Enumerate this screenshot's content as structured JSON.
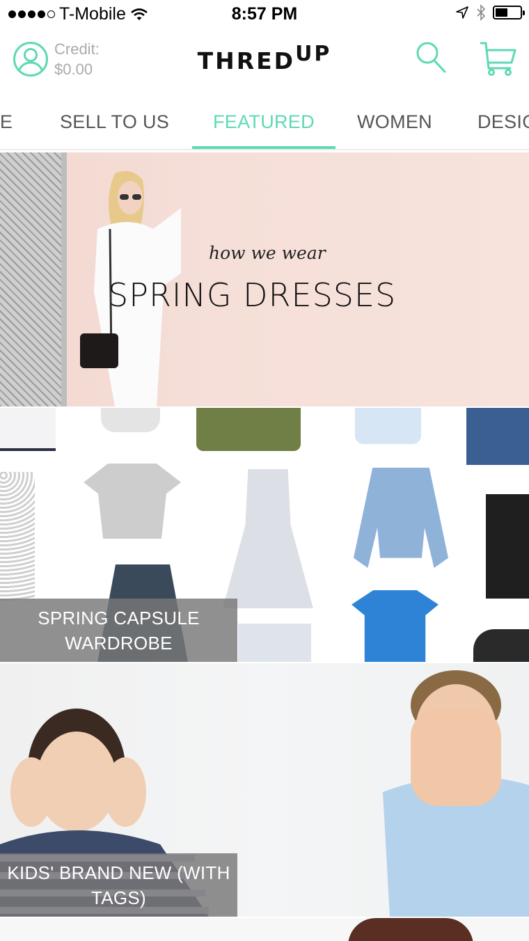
{
  "status_bar": {
    "carrier": "T-Mobile",
    "time": "8:57 PM",
    "signal_bars_filled": 4,
    "signal_bars_total": 5,
    "battery_level": 0.45
  },
  "header": {
    "credit_label": "Credit:",
    "credit_value": "$0.00",
    "logo_main": "THRED",
    "logo_sup": "UP",
    "accent_color": "#5dd9b4"
  },
  "tabs": [
    {
      "label": "SALE"
    },
    {
      "label": "SELL TO US"
    },
    {
      "label": "FEATURED",
      "active": true
    },
    {
      "label": "WOMEN"
    },
    {
      "label": "DESIGNER"
    }
  ],
  "banners": {
    "hero": {
      "subtitle": "how we wear",
      "title": "SPRING DRESSES"
    },
    "capsule": {
      "label": "SPRING CAPSULE WARDROBE"
    },
    "kids": {
      "label": "KIDS' BRAND NEW (WITH TAGS)"
    }
  }
}
